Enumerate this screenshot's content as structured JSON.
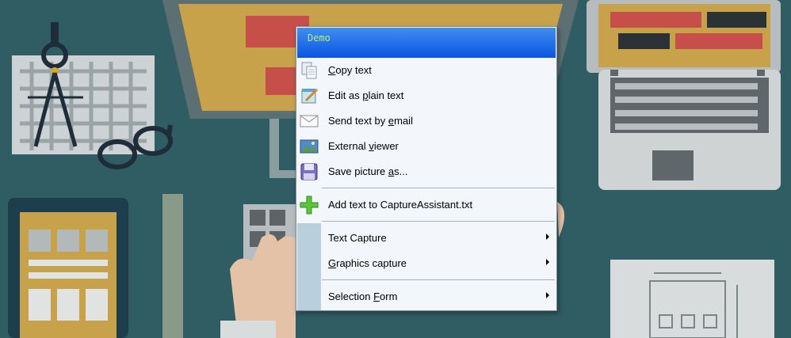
{
  "menu": {
    "title": "Demo",
    "items": [
      {
        "icon": "copy-icon",
        "label": "Copy text",
        "key": "C",
        "rest": "opy text"
      },
      {
        "icon": "notepad-icon",
        "label": "Edit as plain text",
        "pre": "Edit as ",
        "key": "p",
        "rest": "lain text"
      },
      {
        "icon": "envelope-icon",
        "label": "Send text by email",
        "pre": "Send text by ",
        "key": "e",
        "rest": "mail"
      },
      {
        "icon": "picture-icon",
        "label": "External viewer",
        "pre": "External ",
        "key": "v",
        "rest": "iewer"
      },
      {
        "icon": "floppy-disk-icon",
        "label": "Save picture as...",
        "pre": "Save picture ",
        "key": "a",
        "rest": "s..."
      },
      {
        "icon": "plus-icon",
        "label": "Add text to CaptureAssistant.txt"
      },
      {
        "label": "Text Capture",
        "submenu": true
      },
      {
        "label": "Graphics capture",
        "key": "G",
        "rest": "raphics capture",
        "submenu": true
      },
      {
        "label": "Selection Form",
        "pre": "Selection ",
        "key": "F",
        "rest": "orm",
        "submenu": true
      }
    ]
  },
  "colors": {
    "title_bar": "#0a55e0",
    "title_text": "#b6f07a",
    "menu_bg": "#f3f6fa",
    "gutter": "#b9cfdc"
  }
}
